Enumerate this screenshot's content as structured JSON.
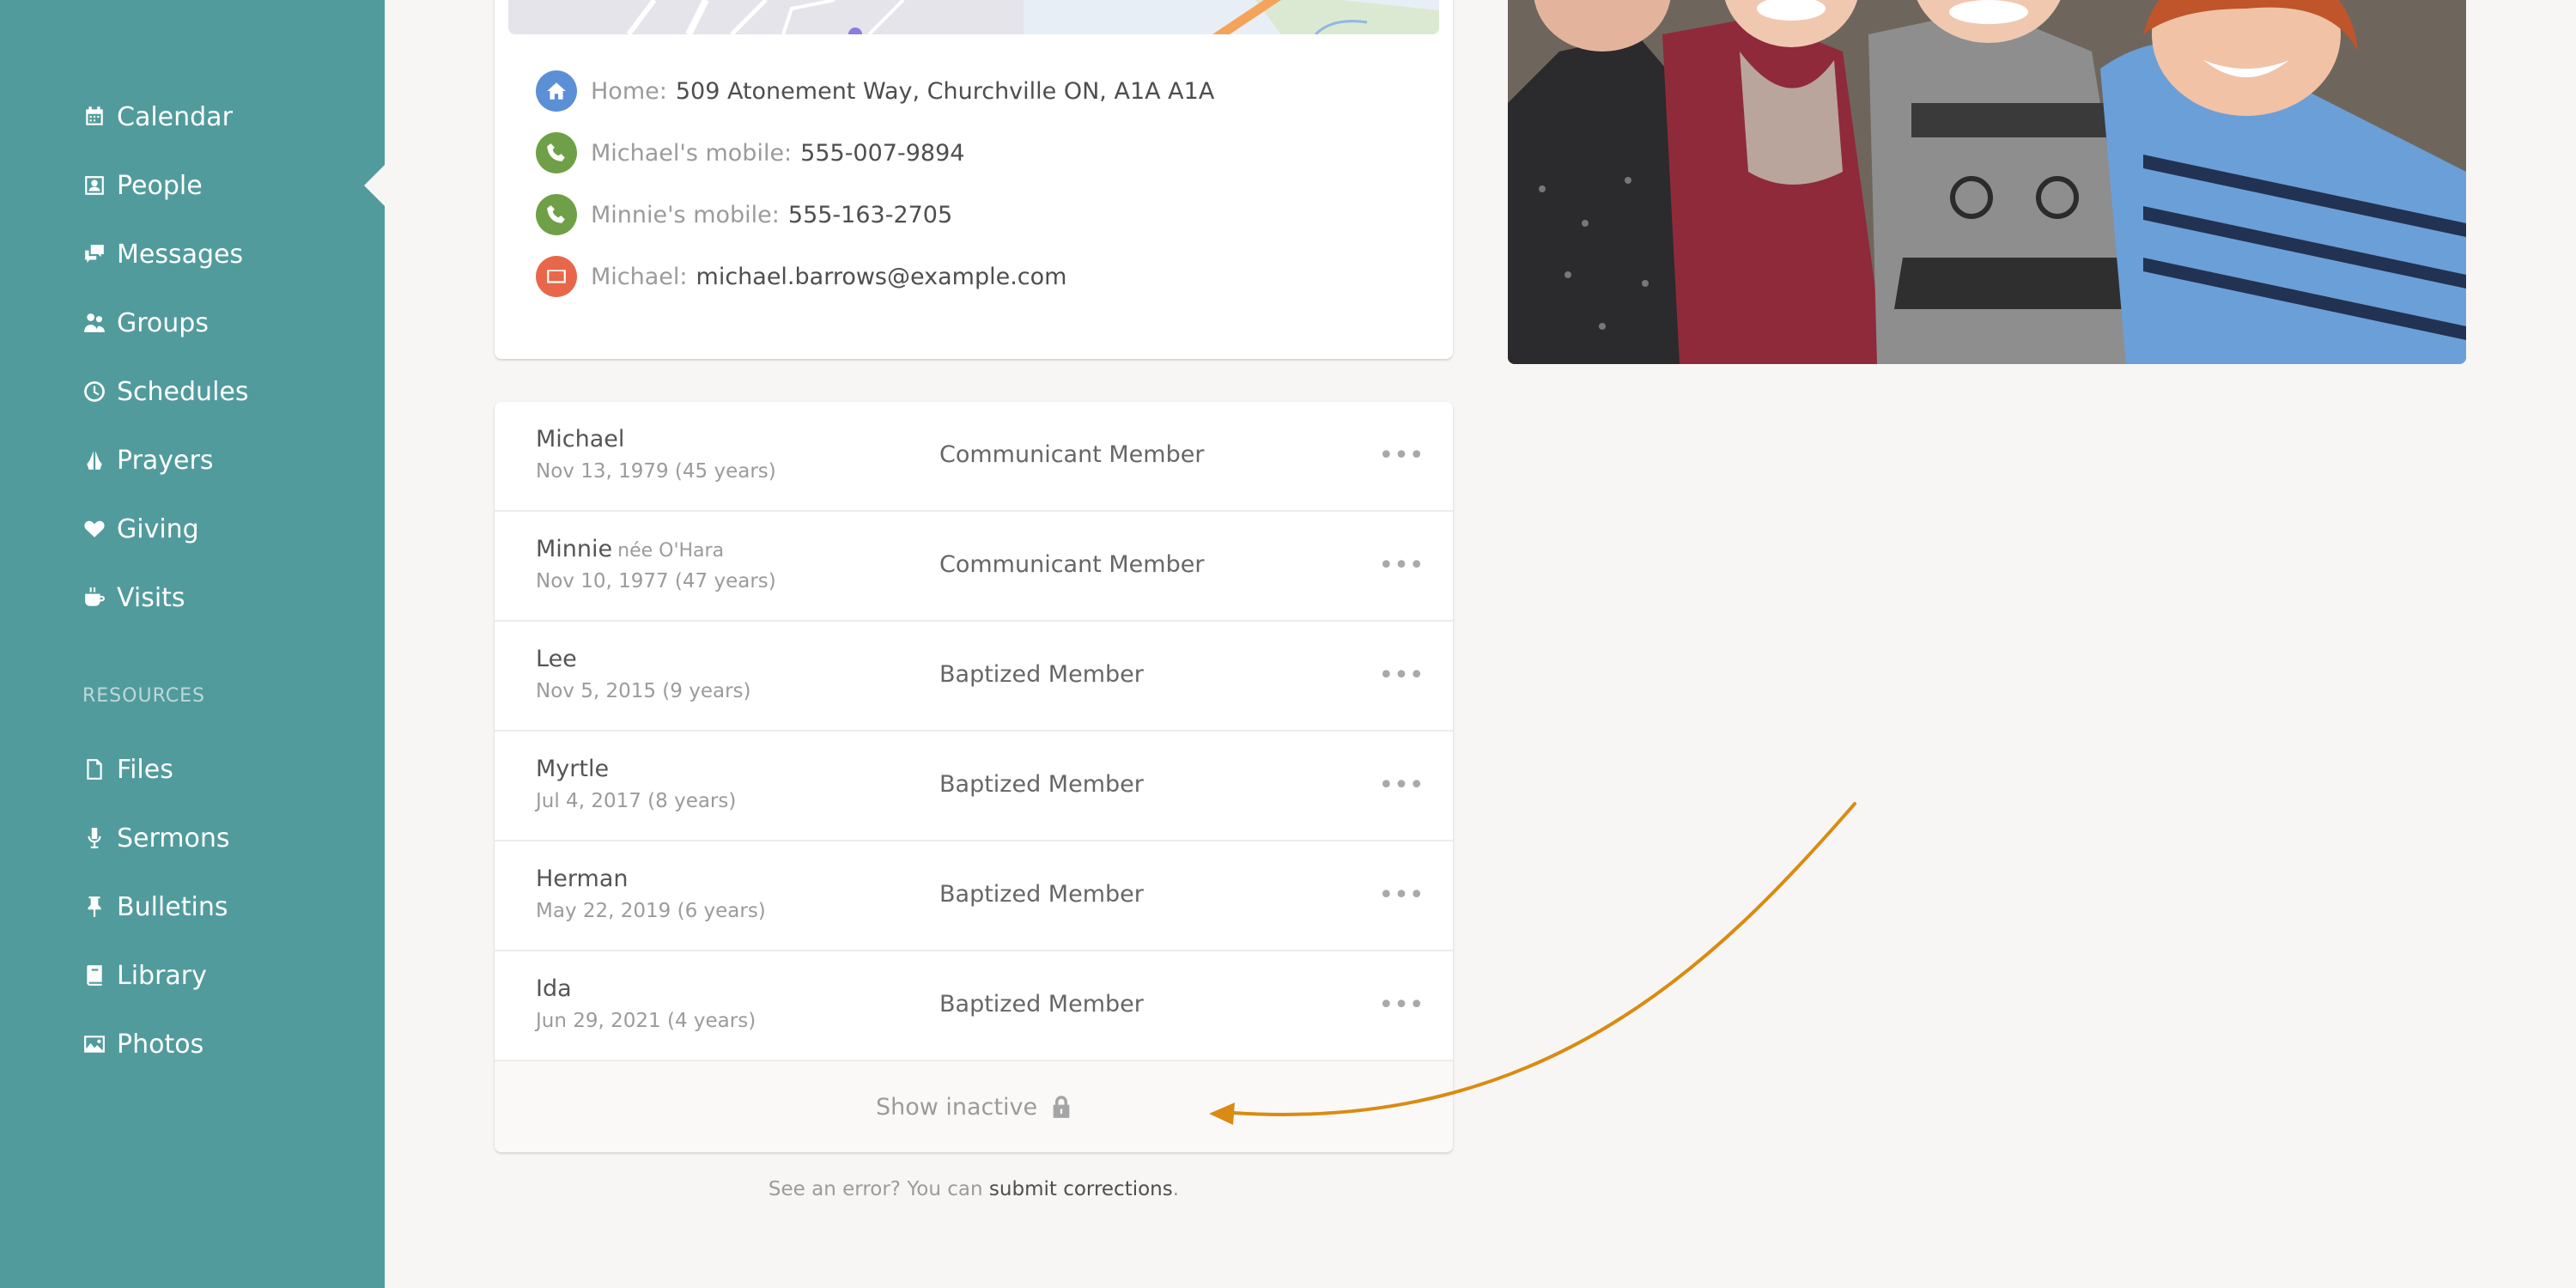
{
  "sidebar": {
    "items": [
      {
        "label": "Calendar",
        "icon": "calendar-icon"
      },
      {
        "label": "People",
        "icon": "contact-card-icon"
      },
      {
        "label": "Messages",
        "icon": "chat-bubbles-icon"
      },
      {
        "label": "Groups",
        "icon": "people-group-icon"
      },
      {
        "label": "Schedules",
        "icon": "clock-icon"
      },
      {
        "label": "Prayers",
        "icon": "praying-hands-icon"
      },
      {
        "label": "Giving",
        "icon": "heart-icon"
      },
      {
        "label": "Visits",
        "icon": "coffee-cup-icon"
      }
    ],
    "resources_label": "RESOURCES",
    "resources": [
      {
        "label": "Files",
        "icon": "file-icon"
      },
      {
        "label": "Sermons",
        "icon": "microphone-icon"
      },
      {
        "label": "Bulletins",
        "icon": "pushpin-icon"
      },
      {
        "label": "Library",
        "icon": "book-icon"
      },
      {
        "label": "Photos",
        "icon": "picture-icon"
      }
    ],
    "active_item": "People",
    "background_color": "#519b9d"
  },
  "contact": {
    "rows": [
      {
        "label": "Home:",
        "value": "509 Atonement Way, Churchville ON, A1A A1A",
        "icon": "home-icon",
        "color": "#5b8fd6"
      },
      {
        "label": "Michael's mobile:",
        "value": "555-007-9894",
        "icon": "phone-icon",
        "color": "#6fa048"
      },
      {
        "label": "Minnie's mobile:",
        "value": "555-163-2705",
        "icon": "phone-icon",
        "color": "#6fa048"
      },
      {
        "label": "Michael:",
        "value": "michael.barrows@example.com",
        "icon": "envelope-icon",
        "color": "#e8674a"
      }
    ]
  },
  "members": [
    {
      "name": "Michael",
      "nee": "",
      "dob": "Nov 13, 1979 (45 years)",
      "role": "Communicant Member"
    },
    {
      "name": "Minnie",
      "nee": "née O'Hara",
      "dob": "Nov 10, 1977 (47 years)",
      "role": "Communicant Member"
    },
    {
      "name": "Lee",
      "nee": "",
      "dob": "Nov 5, 2015 (9 years)",
      "role": "Baptized Member"
    },
    {
      "name": "Myrtle",
      "nee": "",
      "dob": "Jul 4, 2017 (8 years)",
      "role": "Baptized Member"
    },
    {
      "name": "Herman",
      "nee": "",
      "dob": "May 22, 2019 (6 years)",
      "role": "Baptized Member"
    },
    {
      "name": "Ida",
      "nee": "",
      "dob": "Jun 29, 2021 (4 years)",
      "role": "Baptized Member"
    }
  ],
  "member_more": "•••",
  "show_inactive_label": "Show inactive",
  "footer": {
    "prefix": "See an error? You can",
    "link": "submit corrections",
    "suffix": "."
  },
  "annotation_color": "#d98b12"
}
